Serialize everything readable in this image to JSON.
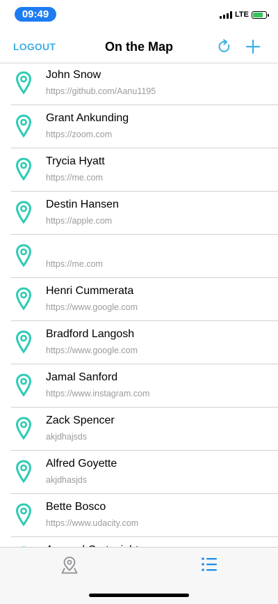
{
  "status_bar": {
    "time": "09:49",
    "network": "LTE"
  },
  "nav": {
    "logout_label": "LOGOUT",
    "title": "On the Map",
    "refresh_icon": "refresh-icon",
    "add_icon": "plus-icon"
  },
  "colors": {
    "accent": "#3EAFE4",
    "pin": "#2BCBB5",
    "time_pill": "#1E7CF2",
    "tab_active": "#1E8BEA",
    "tab_inactive": "#8e8e93"
  },
  "locations": [
    {
      "name": "John Snow",
      "url": "https://github.com/Aanu1195"
    },
    {
      "name": "Grant Ankunding",
      "url": "https://zoom.com"
    },
    {
      "name": "Trycia Hyatt",
      "url": "https://me.com"
    },
    {
      "name": "Destin Hansen",
      "url": "https://apple.com"
    },
    {
      "name": "",
      "url": "https://me.com"
    },
    {
      "name": "Henri Cummerata",
      "url": "https://www.google.com"
    },
    {
      "name": "Bradford Langosh",
      "url": "https://www.google.com"
    },
    {
      "name": "Jamal Sanford",
      "url": "https://www.instagram.com"
    },
    {
      "name": "Zack Spencer",
      "url": "akjdhajsds"
    },
    {
      "name": "Alfred Goyette",
      "url": "akjdhasjds"
    },
    {
      "name": "Bette Bosco",
      "url": "https://www.udacity.com"
    },
    {
      "name": "Armand Cartwright",
      "url": ""
    }
  ],
  "tabs": [
    {
      "name": "tab-map",
      "icon": "map-pin-icon",
      "active": false
    },
    {
      "name": "tab-list",
      "icon": "list-icon",
      "active": true
    }
  ]
}
